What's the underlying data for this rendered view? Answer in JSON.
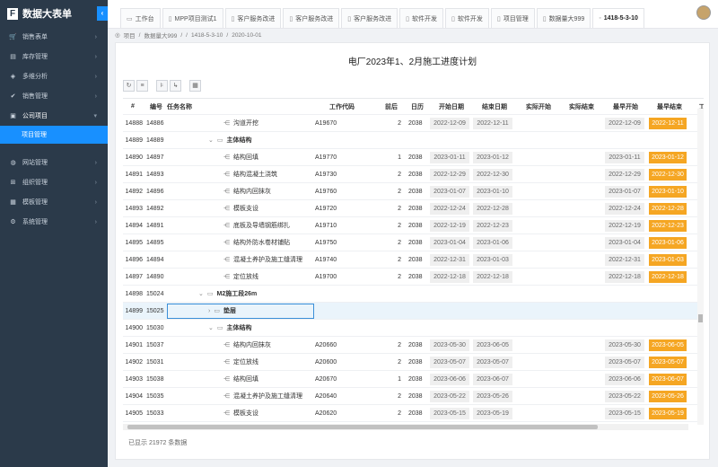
{
  "app": {
    "name": "数据大表单",
    "logo_letter": "F",
    "collapse_icon": "chevron-left"
  },
  "sidebar": {
    "items": [
      {
        "label": "销售表单",
        "icon": "cart-icon"
      },
      {
        "label": "库存管理",
        "icon": "box-icon"
      },
      {
        "label": "多维分析",
        "icon": "cube-icon"
      },
      {
        "label": "销售管理",
        "icon": "check-circle-icon"
      },
      {
        "label": "公司项目",
        "icon": "briefcase-icon",
        "open": true
      },
      {
        "label": "项目管理",
        "sub": true,
        "active": true
      },
      {
        "label": "网站管理",
        "icon": "globe-icon"
      },
      {
        "label": "组织管理",
        "icon": "org-icon"
      },
      {
        "label": "模板管理",
        "icon": "template-icon"
      },
      {
        "label": "系统管理",
        "icon": "settings-icon"
      }
    ]
  },
  "tabs": [
    {
      "label": "工作台",
      "icon": "monitor-icon"
    },
    {
      "label": "MPP项目测试1",
      "icon": "doc-icon"
    },
    {
      "label": "客户服务改进",
      "icon": "doc-icon"
    },
    {
      "label": "客户服务改进",
      "icon": "doc-icon"
    },
    {
      "label": "客户服务改进",
      "icon": "doc-icon"
    },
    {
      "label": "软件开发",
      "icon": "doc-icon"
    },
    {
      "label": "软件开发",
      "icon": "doc-icon"
    },
    {
      "label": "项目管理",
      "icon": "doc-icon"
    },
    {
      "label": "数据量大999",
      "icon": "doc-icon"
    },
    {
      "label": "1418-5-3-10",
      "icon": "dot-icon",
      "active": true
    }
  ],
  "breadcrumb": [
    "项目",
    "/",
    "数据量大999",
    "/",
    "/",
    "1418-5-3-10",
    "/",
    "2020-10-01"
  ],
  "page": {
    "title": "电厂2023年1、2月施工进度计划"
  },
  "toolbar": [
    "refresh-icon",
    "filter-icon",
    "indent-icon",
    "link-icon",
    "calendar-icon"
  ],
  "columns": {
    "seq": "#",
    "no": "编号",
    "name": "任务名称",
    "code": "工作代码",
    "pre": "前后",
    "cal": "日历",
    "ps": "开始日期",
    "pe": "结束日期",
    "as": "实际开始",
    "ae": "实际结束",
    "es": "最早开始",
    "ef": "最早结束",
    "w": "工"
  },
  "rows": [
    {
      "seq": "14888",
      "no": "14886",
      "name": "沟道开挖",
      "lvl": 2,
      "type": "task",
      "code": "A19670",
      "pre": "2",
      "cal": "2038",
      "ps": "2022-12-09",
      "pe": "2022-12-11",
      "es": "2022-12-09",
      "ef": "2022-12-11"
    },
    {
      "seq": "14889",
      "no": "14889",
      "name": "主体结构",
      "lvl": 1,
      "type": "group"
    },
    {
      "seq": "14890",
      "no": "14897",
      "name": "结构回填",
      "lvl": 2,
      "type": "task",
      "code": "A19770",
      "pre": "1",
      "cal": "2038",
      "ps": "2023-01-11",
      "pe": "2023-01-12",
      "es": "2023-01-11",
      "ef": "2023-01-12"
    },
    {
      "seq": "14891",
      "no": "14893",
      "name": "结构混凝土浇筑",
      "lvl": 2,
      "type": "task",
      "code": "A19730",
      "pre": "2",
      "cal": "2038",
      "ps": "2022-12-29",
      "pe": "2022-12-30",
      "es": "2022-12-29",
      "ef": "2022-12-30"
    },
    {
      "seq": "14892",
      "no": "14896",
      "name": "结构内回抹灰",
      "lvl": 2,
      "type": "task",
      "code": "A19760",
      "pre": "2",
      "cal": "2038",
      "ps": "2023-01-07",
      "pe": "2023-01-10",
      "es": "2023-01-07",
      "ef": "2023-01-10"
    },
    {
      "seq": "14893",
      "no": "14892",
      "name": "模板支设",
      "lvl": 2,
      "type": "task",
      "code": "A19720",
      "pre": "2",
      "cal": "2038",
      "ps": "2022-12-24",
      "pe": "2022-12-28",
      "es": "2022-12-24",
      "ef": "2022-12-28"
    },
    {
      "seq": "14894",
      "no": "14891",
      "name": "底板及导墙钢筋绑扎",
      "lvl": 2,
      "type": "task",
      "code": "A19710",
      "pre": "2",
      "cal": "2038",
      "ps": "2022-12-19",
      "pe": "2022-12-23",
      "es": "2022-12-19",
      "ef": "2022-12-23"
    },
    {
      "seq": "14895",
      "no": "14895",
      "name": "结构外防水卷材铺贴",
      "lvl": 2,
      "type": "task",
      "code": "A19750",
      "pre": "2",
      "cal": "2038",
      "ps": "2023-01-04",
      "pe": "2023-01-06",
      "es": "2023-01-04",
      "ef": "2023-01-06"
    },
    {
      "seq": "14896",
      "no": "14894",
      "name": "混凝土养护及施工缝清理",
      "lvl": 2,
      "type": "task",
      "code": "A19740",
      "pre": "2",
      "cal": "2038",
      "ps": "2022-12-31",
      "pe": "2023-01-03",
      "es": "2022-12-31",
      "ef": "2023-01-03"
    },
    {
      "seq": "14897",
      "no": "14890",
      "name": "定位放线",
      "lvl": 2,
      "type": "task",
      "code": "A19700",
      "pre": "2",
      "cal": "2038",
      "ps": "2022-12-18",
      "pe": "2022-12-18",
      "es": "2022-12-18",
      "ef": "2022-12-18"
    },
    {
      "seq": "14898",
      "no": "15024",
      "name": "M2施工段26m",
      "lvl": 0,
      "type": "group"
    },
    {
      "seq": "14899",
      "no": "15025",
      "name": "垫层",
      "lvl": 1,
      "type": "folder",
      "selected": true
    },
    {
      "seq": "14900",
      "no": "15030",
      "name": "主体结构",
      "lvl": 1,
      "type": "group"
    },
    {
      "seq": "14901",
      "no": "15037",
      "name": "结构内回抹灰",
      "lvl": 2,
      "type": "task",
      "code": "A20660",
      "pre": "2",
      "cal": "2038",
      "ps": "2023-05-30",
      "pe": "2023-06-05",
      "es": "2023-05-30",
      "ef": "2023-06-05"
    },
    {
      "seq": "14902",
      "no": "15031",
      "name": "定位放线",
      "lvl": 2,
      "type": "task",
      "code": "A20600",
      "pre": "2",
      "cal": "2038",
      "ps": "2023-05-07",
      "pe": "2023-05-07",
      "es": "2023-05-07",
      "ef": "2023-05-07"
    },
    {
      "seq": "14903",
      "no": "15038",
      "name": "结构回填",
      "lvl": 2,
      "type": "task",
      "code": "A20670",
      "pre": "1",
      "cal": "2038",
      "ps": "2023-06-06",
      "pe": "2023-06-07",
      "es": "2023-06-06",
      "ef": "2023-06-07"
    },
    {
      "seq": "14904",
      "no": "15035",
      "name": "混凝土养护及施工缝清理",
      "lvl": 2,
      "type": "task",
      "code": "A20640",
      "pre": "2",
      "cal": "2038",
      "ps": "2023-05-22",
      "pe": "2023-05-26",
      "es": "2023-05-22",
      "ef": "2023-05-26"
    },
    {
      "seq": "14905",
      "no": "15033",
      "name": "模板支设",
      "lvl": 2,
      "type": "task",
      "code": "A20620",
      "pre": "2",
      "cal": "2038",
      "ps": "2023-05-15",
      "pe": "2023-05-19",
      "es": "2023-05-15",
      "ef": "2023-05-19"
    }
  ],
  "footer": {
    "text": "已显示 21972 条数据"
  }
}
